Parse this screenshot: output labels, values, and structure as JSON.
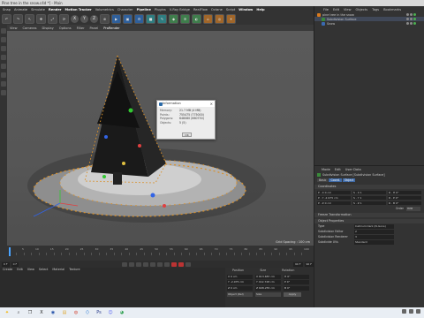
{
  "window": {
    "title": "Pine tree in the snow.c4d *] - Main"
  },
  "menubar": [
    "Snap",
    "Animate",
    "Simulate",
    "Render",
    "Motion Tracker",
    "Volumetrics",
    "Character",
    "Pipeline",
    "Plugins",
    "V-Ray Bridge",
    "RealFlow",
    "Octane",
    "Script",
    "Window",
    "Help"
  ],
  "menubar_highlight": [
    "Render",
    "Motion Tracker",
    "Pipeline",
    "Window",
    "Help"
  ],
  "toolbar": {
    "buttons": [
      {
        "icon": "undo-icon",
        "glyph": "↶"
      },
      {
        "icon": "redo-icon",
        "glyph": "↷"
      },
      {
        "icon": "select-icon",
        "glyph": "↖"
      },
      {
        "icon": "move-icon",
        "glyph": "✥"
      },
      {
        "icon": "scale-icon",
        "glyph": "⤢"
      },
      {
        "icon": "rotate-icon",
        "glyph": "⟳"
      },
      {
        "icon": "x-axis-icon",
        "glyph": "X"
      },
      {
        "icon": "y-axis-icon",
        "glyph": "Y"
      },
      {
        "icon": "z-axis-icon",
        "glyph": "Z"
      },
      {
        "icon": "coord-system-icon",
        "glyph": "⊕"
      },
      {
        "icon": "render-view-icon",
        "glyph": "▶"
      },
      {
        "icon": "render-picture-viewer-icon",
        "glyph": "▣"
      },
      {
        "icon": "render-settings-icon",
        "glyph": "⚙"
      },
      {
        "icon": "cube-icon",
        "glyph": "■"
      },
      {
        "icon": "pen-icon",
        "glyph": "✎"
      },
      {
        "icon": "subdivision-icon",
        "glyph": "◆"
      },
      {
        "icon": "array-icon",
        "glyph": "✲"
      },
      {
        "icon": "deformer-icon",
        "glyph": "◐"
      },
      {
        "icon": "scene-icon",
        "glyph": "⌂"
      },
      {
        "icon": "camera-icon",
        "glyph": "◎"
      },
      {
        "icon": "light-icon",
        "glyph": "☀"
      }
    ]
  },
  "viewport": {
    "menu": [
      "View",
      "Cameras",
      "Display",
      "Options",
      "Filter",
      "Panel",
      "ProRender"
    ],
    "grid_spacing": "Grid Spacing : 100 cm"
  },
  "info_dialog": {
    "title": "Information",
    "rows": [
      {
        "key": "Memory:",
        "value": "21.7 MB (4 MB)"
      },
      {
        "key": "Points:",
        "value": "755475 (775000)"
      },
      {
        "key": "Polygons:",
        "value": "648080 (660730)"
      },
      {
        "key": "Objects:",
        "value": "5 (5)"
      }
    ],
    "ok": "OK"
  },
  "timeline": {
    "ticks": [
      "0",
      "5",
      "10",
      "15",
      "20",
      "25",
      "30",
      "35",
      "40",
      "45",
      "50",
      "55",
      "60",
      "65",
      "70",
      "75",
      "80",
      "85",
      "90",
      "95",
      "100"
    ],
    "start": "0 F",
    "current": "0 F",
    "end": "90 F",
    "end2": "90 F"
  },
  "bottom_left_menu": [
    "Create",
    "Edit",
    "View",
    "Select",
    "Material",
    "Texture"
  ],
  "coordinates": {
    "headers": [
      "Position",
      "Size",
      "Rotation"
    ],
    "rows": [
      {
        "pos": "X  0 cm",
        "size": "X  613.687 cm",
        "rot": "H  0°"
      },
      {
        "pos": "Y  -2.975 cm",
        "size": "Y  412.728 cm",
        "rot": "P  0°"
      },
      {
        "pos": "Z  0 cm",
        "size": "Z  608.255 cm",
        "rot": "B  0°"
      }
    ],
    "mode": "Object (Rel)",
    "size_mode": "Size",
    "apply": "Apply"
  },
  "object_manager": {
    "menu": [
      "File",
      "Edit",
      "View",
      "Objects",
      "Tags",
      "Bookmarks"
    ],
    "rows": [
      {
        "label": "pine tree in the snow",
        "icon": "o",
        "selected": false
      },
      {
        "label": "Subdivision Surface",
        "icon": "g",
        "selected": true
      },
      {
        "label": "Snow",
        "icon": "b",
        "selected": false
      }
    ]
  },
  "attribute_manager": {
    "menu": [
      "Mode",
      "Edit",
      "User Data"
    ],
    "object_label": "Subdivision Surface [Subdivision Surface]",
    "tabs": [
      "Basic",
      "Coord.",
      "Object"
    ],
    "sections": {
      "coordinates": "Coordinates",
      "coord_rows": [
        [
          "P . X  0 cm",
          "S . X  1",
          "R . H  0°"
        ],
        [
          "P . Y  -2.975 cm",
          "S . Y  1",
          "R . P  0°"
        ],
        [
          "P . Z  0 cm",
          "S . Z  1",
          "R . B  0°"
        ]
      ],
      "order_label": "Order",
      "order_value": "HPB",
      "freeze": "Freeze Transformation",
      "object": "Object Properties",
      "props": [
        {
          "key": "Type",
          "value": "Catmull-Clark (N-Gons)"
        },
        {
          "key": "Subdivision Editor",
          "value": "2"
        },
        {
          "key": "Subdivision Renderer",
          "value": "3"
        },
        {
          "key": "Subdivide UVs",
          "value": "Standard"
        }
      ]
    }
  },
  "taskbar": {
    "icons": [
      {
        "name": "start-icon",
        "glyph": "✦"
      },
      {
        "name": "search-icon",
        "glyph": "⌕"
      },
      {
        "name": "task-view-icon",
        "glyph": "❐"
      },
      {
        "name": "app-x-icon",
        "glyph": "X"
      },
      {
        "name": "cinema4d-icon",
        "glyph": "◉"
      },
      {
        "name": "folder-icon",
        "glyph": "▤"
      },
      {
        "name": "browser-icon",
        "glyph": "◍"
      },
      {
        "name": "vscode-icon",
        "glyph": "⟨⟩"
      },
      {
        "name": "photoshop-icon",
        "glyph": "Ps"
      },
      {
        "name": "discord-icon",
        "glyph": "☺"
      },
      {
        "name": "chrome-icon",
        "glyph": "◕"
      }
    ]
  },
  "colors": {
    "accent": "#3f6aa6",
    "viewport_bg": "#565656",
    "selection": "#4aa3ff"
  }
}
